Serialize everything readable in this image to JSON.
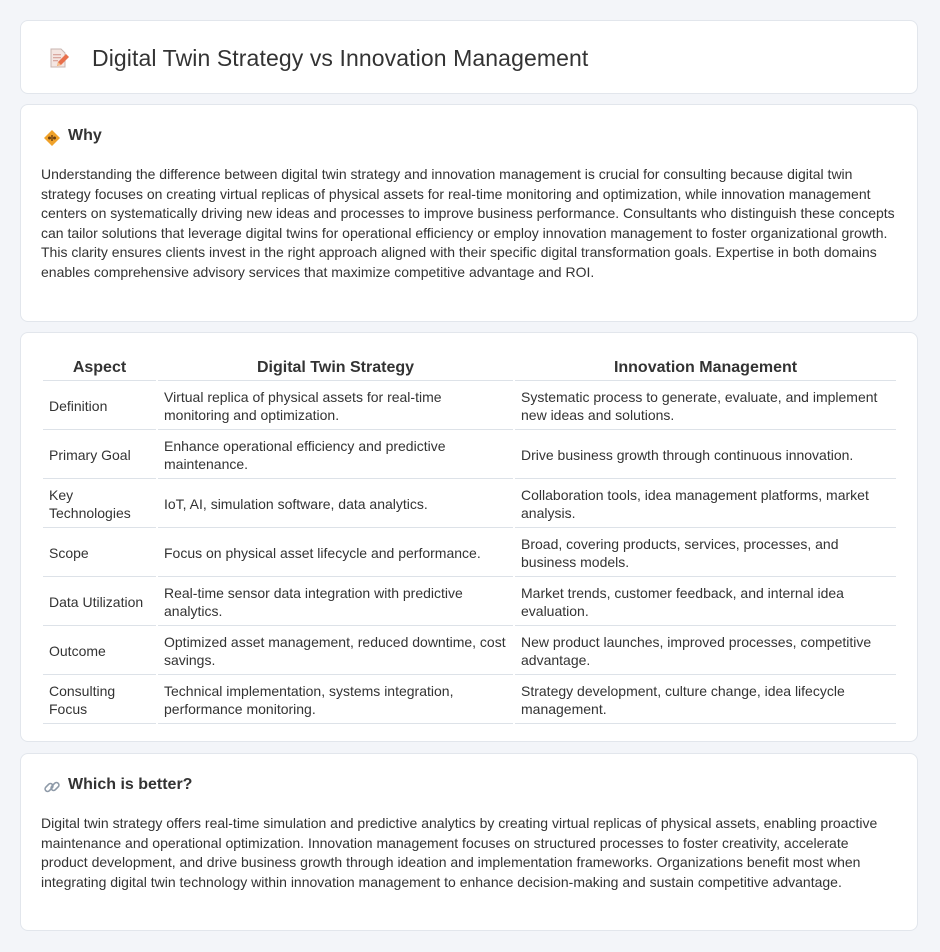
{
  "header": {
    "title": "Digital Twin Strategy vs Innovation Management",
    "icon": "document-pencil-icon"
  },
  "why": {
    "title": "Why",
    "icon": "lightbulb-icon",
    "text": "Understanding the difference between digital twin strategy and innovation management is crucial for consulting because digital twin strategy focuses on creating virtual replicas of physical assets for real-time monitoring and optimization, while innovation management centers on systematically driving new ideas and processes to improve business performance. Consultants who distinguish these concepts can tailor solutions that leverage digital twins for operational efficiency or employ innovation management to foster organizational growth. This clarity ensures clients invest in the right approach aligned with their specific digital transformation goals. Expertise in both domains enables comprehensive advisory services that maximize competitive advantage and ROI."
  },
  "table": {
    "headers": [
      "Aspect",
      "Digital Twin Strategy",
      "Innovation Management"
    ],
    "rows": [
      [
        "Definition",
        "Virtual replica of physical assets for real-time monitoring and optimization.",
        "Systematic process to generate, evaluate, and implement new ideas and solutions."
      ],
      [
        "Primary Goal",
        "Enhance operational efficiency and predictive maintenance.",
        "Drive business growth through continuous innovation."
      ],
      [
        "Key Technologies",
        "IoT, AI, simulation software, data analytics.",
        "Collaboration tools, idea management platforms, market analysis."
      ],
      [
        "Scope",
        "Focus on physical asset lifecycle and performance.",
        "Broad, covering products, services, processes, and business models."
      ],
      [
        "Data Utilization",
        "Real-time sensor data integration with predictive analytics.",
        "Market trends, customer feedback, and internal idea evaluation."
      ],
      [
        "Outcome",
        "Optimized asset management, reduced downtime, cost savings.",
        "New product launches, improved processes, competitive advantage."
      ],
      [
        "Consulting Focus",
        "Technical implementation, systems integration, performance monitoring.",
        "Strategy development, culture change, idea lifecycle management."
      ]
    ]
  },
  "better": {
    "title": "Which is better?",
    "icon": "link-icon",
    "text": "Digital twin strategy offers real-time simulation and predictive analytics by creating virtual replicas of physical assets, enabling proactive maintenance and operational optimization. Innovation management focuses on structured processes to foster creativity, accelerate product development, and drive business growth through ideation and implementation frameworks. Organizations benefit most when integrating digital twin technology within innovation management to enhance decision-making and sustain competitive advantage."
  },
  "colors": {
    "background": "#f3f5f9",
    "card": "#ffffff",
    "text": "#333333",
    "border": "#dde2e8"
  }
}
